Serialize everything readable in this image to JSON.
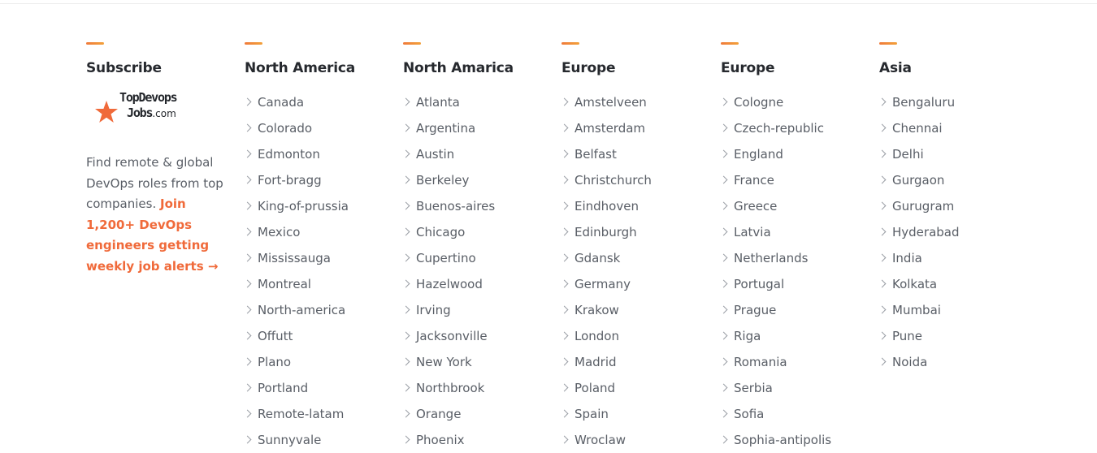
{
  "colors": {
    "accent": "#f07a3a",
    "heading": "#26292e",
    "link": "#595e66",
    "cta": "#f06a3a"
  },
  "subscribe": {
    "title": "Subscribe",
    "logo": {
      "line1": "TopDevops",
      "line2": "Jobs",
      "suffix": ".com",
      "icon": "star-icon"
    },
    "text": "Find remote & global DevOps roles from top companies.",
    "cta": "Join 1,200+ DevOps engineers getting weekly job alerts →"
  },
  "columns": [
    {
      "title": "North America",
      "items": [
        "Canada",
        "Colorado",
        "Edmonton",
        "Fort-bragg",
        "King-of-prussia",
        "Mexico",
        "Mississauga",
        "Montreal",
        "North-america",
        "Offutt",
        "Plano",
        "Portland",
        "Remote-latam",
        "Sunnyvale"
      ]
    },
    {
      "title": "North Amarica",
      "items": [
        "Atlanta",
        "Argentina",
        "Austin",
        "Berkeley",
        "Buenos-aires",
        "Chicago",
        "Cupertino",
        "Hazelwood",
        "Irving",
        "Jacksonville",
        "New York",
        "Northbrook",
        "Orange",
        "Phoenix"
      ]
    },
    {
      "title": "Europe",
      "items": [
        "Amstelveen",
        "Amsterdam",
        "Belfast",
        "Christchurch",
        "Eindhoven",
        "Edinburgh",
        "Gdansk",
        "Germany",
        "Krakow",
        "London",
        "Madrid",
        "Poland",
        "Spain",
        "Wroclaw"
      ]
    },
    {
      "title": "Europe",
      "items": [
        "Cologne",
        "Czech-republic",
        "England",
        "France",
        "Greece",
        "Latvia",
        "Netherlands",
        "Portugal",
        "Prague",
        "Riga",
        "Romania",
        "Serbia",
        "Sofia",
        "Sophia-antipolis"
      ]
    },
    {
      "title": "Asia",
      "items": [
        "Bengaluru",
        "Chennai",
        "Delhi",
        "Gurgaon",
        "Gurugram",
        "Hyderabad",
        "India",
        "Kolkata",
        "Mumbai",
        "Pune",
        "Noida"
      ]
    }
  ]
}
